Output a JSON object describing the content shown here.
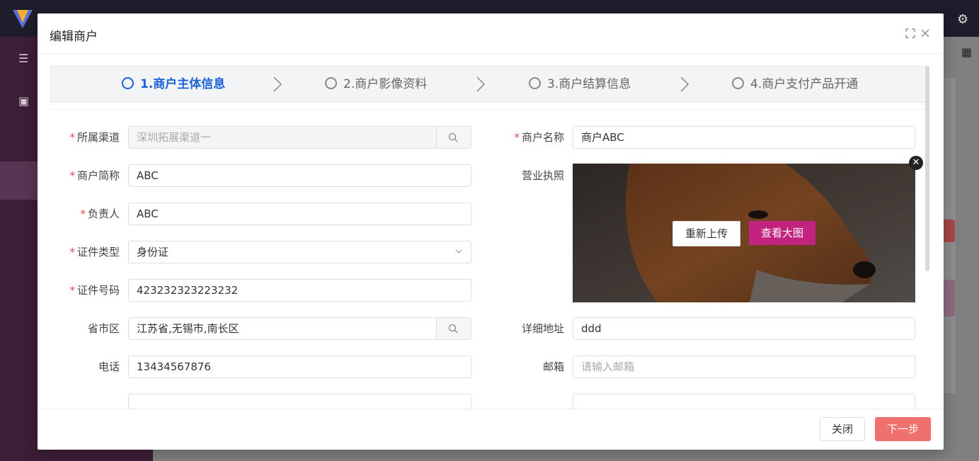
{
  "modal": {
    "title": "编辑商户",
    "steps": [
      {
        "label": "1.商户主体信息",
        "active": true
      },
      {
        "label": "2.商户影像资料",
        "active": false
      },
      {
        "label": "3.商户结算信息",
        "active": false
      },
      {
        "label": "4.商户支付产品开通",
        "active": false
      }
    ],
    "form": {
      "channel": {
        "label": "所属渠道",
        "value": "深圳拓展渠道一",
        "required": true
      },
      "merchant_name": {
        "label": "商户名称",
        "value": "商户ABC",
        "required": true
      },
      "short_name": {
        "label": "商户简称",
        "value": "ABC",
        "required": true
      },
      "business_license": {
        "label": "营业执照"
      },
      "owner": {
        "label": "负责人",
        "value": "ABC",
        "required": true
      },
      "id_type": {
        "label": "证件类型",
        "value": "身份证",
        "required": true
      },
      "id_number": {
        "label": "证件号码",
        "value": "423232323223232",
        "required": true
      },
      "region": {
        "label": "省市区",
        "value": "江苏省,无锡市,南长区"
      },
      "address": {
        "label": "详细地址",
        "value": "ddd"
      },
      "phone": {
        "label": "电话",
        "value": "13434567876"
      },
      "email": {
        "label": "邮箱",
        "placeholder": "请输入邮箱"
      }
    },
    "image_overlay": {
      "reupload": "重新上传",
      "view_large": "查看大图",
      "close_symbol": "✕"
    },
    "footer": {
      "close": "关闭",
      "next": "下一步"
    }
  },
  "icons": {
    "header": [
      "fullscreen-icon",
      "close-icon"
    ],
    "background": [
      "settings-icon",
      "grid-icon"
    ]
  },
  "colors": {
    "active_step": "#1e63d6",
    "primary_button": "#f07070",
    "view_button": "#c2237e",
    "required": "#e5484d"
  }
}
